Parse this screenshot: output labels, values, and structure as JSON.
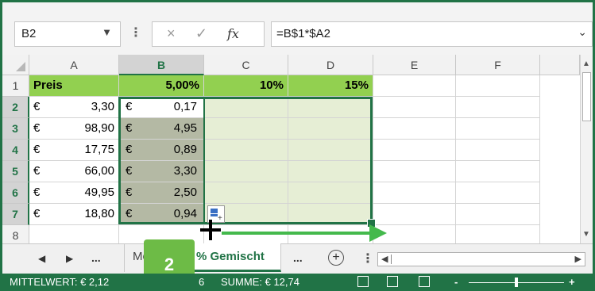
{
  "formula_bar": {
    "name_box": "B2",
    "cancel_glyph": "×",
    "enter_glyph": "✓",
    "fx_label": "fx",
    "formula": "=B$1*$A2"
  },
  "columns": [
    "A",
    "B",
    "C",
    "D",
    "E",
    "F"
  ],
  "rows": [
    "1",
    "2",
    "3",
    "4",
    "5",
    "6",
    "7",
    "8"
  ],
  "header_row": {
    "a": "Preis",
    "b": "5,00%",
    "c": "10%",
    "d": "15%"
  },
  "currency": "€",
  "data_rows": [
    {
      "a": "3,30",
      "b": "0,17"
    },
    {
      "a": "98,90",
      "b": "4,95"
    },
    {
      "a": "17,75",
      "b": "0,89"
    },
    {
      "a": "66,00",
      "b": "3,30"
    },
    {
      "a": "49,95",
      "b": "2,50"
    },
    {
      "a": "18,80",
      "b": "0,94"
    }
  ],
  "tabs": {
    "nav_prev": "◀",
    "nav_next": "▶",
    "nav_more": "...",
    "inactive_tab": "Mö",
    "active_tab": "% Gemischt",
    "more": "...",
    "add": "+",
    "options": "⋮"
  },
  "step_badge": "2",
  "status_bar": {
    "average": "MITTELWERT: € 2,12",
    "count_fragment": "6",
    "sum": "SUMME: € 12,74",
    "zoom_minus": "-",
    "zoom_plus": "+"
  },
  "colors": {
    "accent": "#217346",
    "header_green": "#92d050",
    "arrow_green": "#44b94c",
    "badge_green": "#6dbb46"
  }
}
